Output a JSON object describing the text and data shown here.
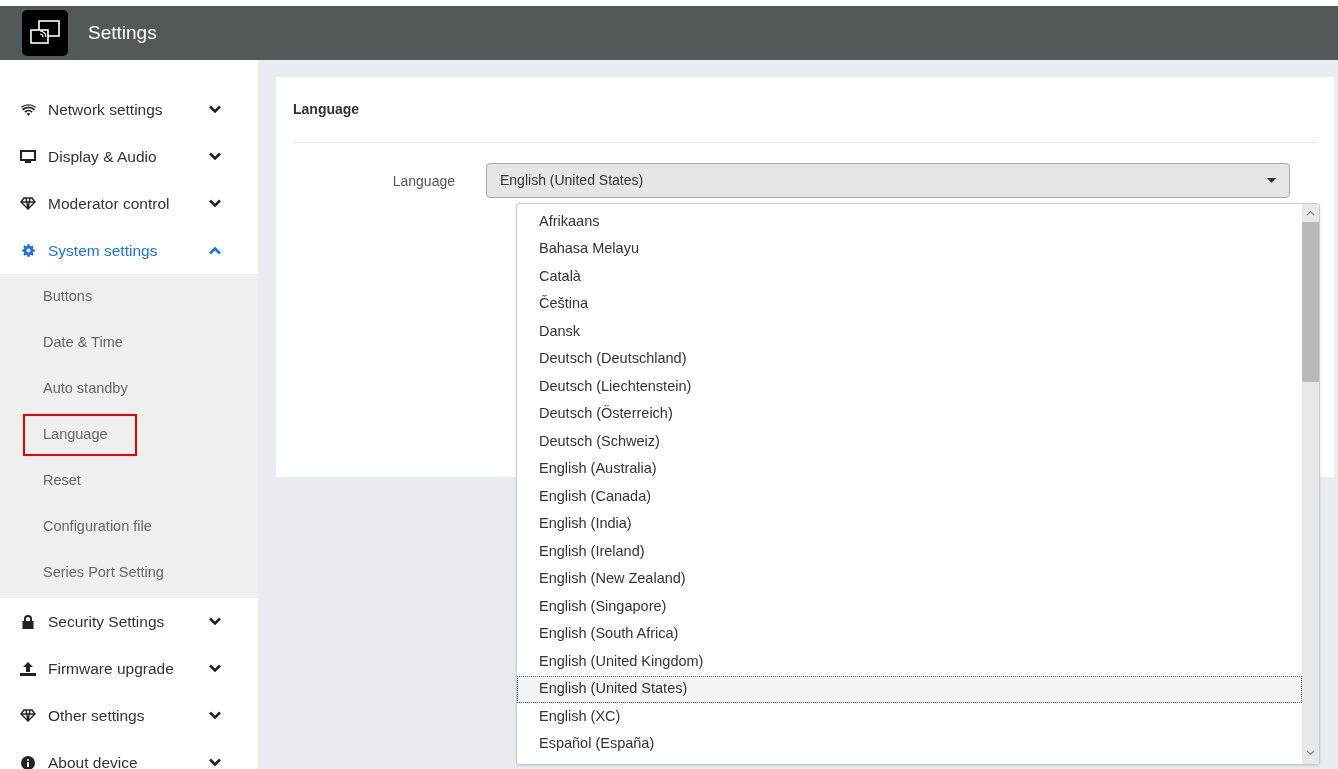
{
  "header": {
    "title": "Settings"
  },
  "sidebar": {
    "items": [
      {
        "label": "Network settings",
        "kind": "wifi",
        "expanded": false
      },
      {
        "label": "Display & Audio",
        "kind": "monitor",
        "expanded": false
      },
      {
        "label": "Moderator control",
        "kind": "diamond",
        "expanded": false
      },
      {
        "label": "System settings",
        "kind": "gear",
        "expanded": true,
        "children": [
          {
            "label": "Buttons",
            "selected": false
          },
          {
            "label": "Date & Time",
            "selected": false
          },
          {
            "label": "Auto standby",
            "selected": false
          },
          {
            "label": "Language",
            "selected": true
          },
          {
            "label": "Reset",
            "selected": false
          },
          {
            "label": "Configuration file",
            "selected": false
          },
          {
            "label": "Series Port Setting",
            "selected": false
          }
        ]
      },
      {
        "label": "Security Settings",
        "kind": "lock",
        "expanded": false
      },
      {
        "label": "Firmware upgrade",
        "kind": "upload",
        "expanded": false
      },
      {
        "label": "Other settings",
        "kind": "diamond",
        "expanded": false
      },
      {
        "label": "About device",
        "kind": "info",
        "expanded": false
      }
    ]
  },
  "panel": {
    "title": "Language",
    "field_label": "Language",
    "select": {
      "value": "English (United States)",
      "expanded": true,
      "options": [
        {
          "label": "Afrikaans",
          "selected": false
        },
        {
          "label": "Bahasa Melayu",
          "selected": false
        },
        {
          "label": "Català",
          "selected": false
        },
        {
          "label": "Čeština",
          "selected": false
        },
        {
          "label": "Dansk",
          "selected": false
        },
        {
          "label": "Deutsch (Deutschland)",
          "selected": false
        },
        {
          "label": "Deutsch (Liechtenstein)",
          "selected": false
        },
        {
          "label": "Deutsch (Österreich)",
          "selected": false
        },
        {
          "label": "Deutsch (Schweiz)",
          "selected": false
        },
        {
          "label": "English (Australia)",
          "selected": false
        },
        {
          "label": "English (Canada)",
          "selected": false
        },
        {
          "label": "English (India)",
          "selected": false
        },
        {
          "label": "English (Ireland)",
          "selected": false
        },
        {
          "label": "English (New Zealand)",
          "selected": false
        },
        {
          "label": "English (Singapore)",
          "selected": false
        },
        {
          "label": "English (South Africa)",
          "selected": false
        },
        {
          "label": "English (United Kingdom)",
          "selected": false
        },
        {
          "label": "English (United States)",
          "selected": true
        },
        {
          "label": "English (XC)",
          "selected": false
        },
        {
          "label": "Español (España)",
          "selected": false
        }
      ]
    }
  }
}
